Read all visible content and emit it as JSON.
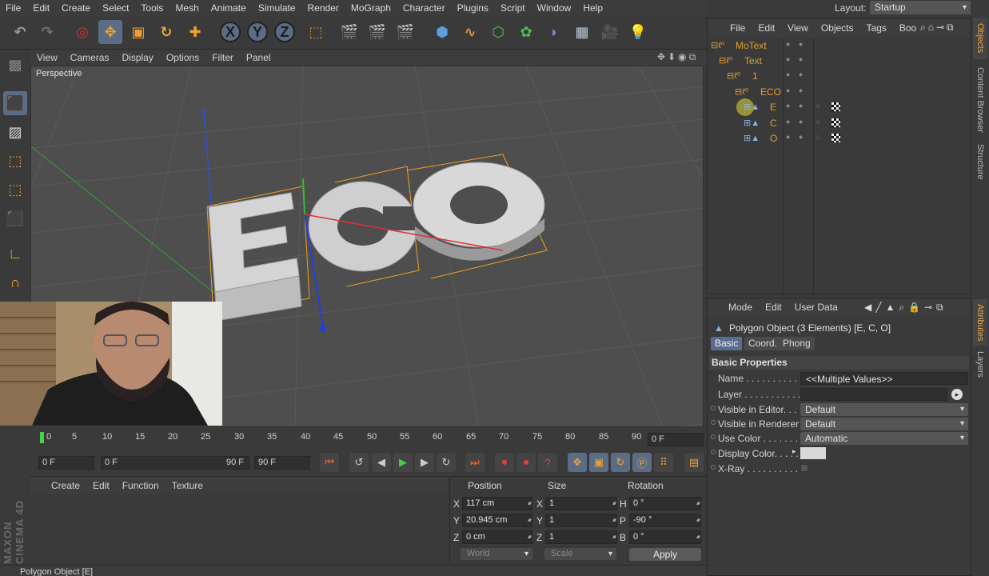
{
  "menubar": [
    "File",
    "Edit",
    "Create",
    "Select",
    "Tools",
    "Mesh",
    "Animate",
    "Simulate",
    "Render",
    "MoGraph",
    "Character",
    "Plugins",
    "Script",
    "Window",
    "Help"
  ],
  "layout": {
    "label": "Layout:",
    "value": "Startup"
  },
  "toolbar": {
    "x_axis": "X",
    "y_axis": "Y",
    "z_axis": "Z"
  },
  "viewport": {
    "menu": [
      "View",
      "Cameras",
      "Display",
      "Options",
      "Filter",
      "Panel"
    ],
    "label": "Perspective",
    "text3d": "ECO",
    "axis_label": "Z"
  },
  "timeline": {
    "ticks": [
      "0",
      "5",
      "10",
      "15",
      "20",
      "25",
      "30",
      "35",
      "40",
      "45",
      "50",
      "55",
      "60",
      "65",
      "70",
      "75",
      "80",
      "85",
      "90"
    ],
    "current_frame": "0 F",
    "start": "0 F",
    "range_start": "0 F",
    "range_end": "90 F",
    "end": "90 F"
  },
  "material_manager": {
    "menu": [
      "Create",
      "Edit",
      "Function",
      "Texture"
    ]
  },
  "brand": "MAXON CINEMA 4D",
  "coords": {
    "headers": {
      "position": "Position",
      "size": "Size",
      "rotation": "Rotation"
    },
    "rows": [
      {
        "axis": "X",
        "position": "117 cm",
        "size_axis": "X",
        "size": "1",
        "rot_axis": "H",
        "rotation": "0 °"
      },
      {
        "axis": "Y",
        "position": "20.945 cm",
        "size_axis": "Y",
        "size": "1",
        "rot_axis": "P",
        "rotation": "-90 °"
      },
      {
        "axis": "Z",
        "position": "0 cm",
        "size_axis": "Z",
        "size": "1",
        "rot_axis": "B",
        "rotation": "0 °"
      }
    ],
    "space": "World",
    "mode": "Scale",
    "apply": "Apply"
  },
  "statusbar": "Polygon Object [E]",
  "objects": {
    "menu": [
      "File",
      "Edit",
      "View",
      "Objects",
      "Tags",
      "Boo"
    ],
    "tree": [
      {
        "name": "MoText",
        "indent": 0
      },
      {
        "name": "Text",
        "indent": 1
      },
      {
        "name": "1",
        "indent": 2
      },
      {
        "name": "ECO",
        "indent": 3
      },
      {
        "name": "E",
        "indent": 4
      },
      {
        "name": "C",
        "indent": 4
      },
      {
        "name": "O",
        "indent": 4
      }
    ]
  },
  "attributes": {
    "menu": [
      "Mode",
      "Edit",
      "User Data"
    ],
    "title": "Polygon Object (3 Elements) [E, C, O]",
    "tabs": [
      "Basic",
      "Coord.",
      "Phong"
    ],
    "section": "Basic Properties",
    "props": [
      {
        "label": "Name . . . . . . . . . . .",
        "value": "<<Multiple Values>>"
      },
      {
        "label": "Layer . . . . . . . . . . .",
        "value": ""
      },
      {
        "label": "Visible in Editor. . .",
        "value": "Default"
      },
      {
        "label": "Visible in Renderer",
        "value": "Default"
      },
      {
        "label": "Use Color . . . . . . . .",
        "value": "Automatic"
      },
      {
        "label": "Display Color. . . . .",
        "value": ""
      },
      {
        "label": "X-Ray . . . . . . . . . .",
        "value": ""
      }
    ]
  },
  "side_tabs": {
    "objects": "Objects",
    "content_browser": "Content Browser",
    "structure": "Structure",
    "attributes": "Attributes",
    "layers": "Layers"
  }
}
